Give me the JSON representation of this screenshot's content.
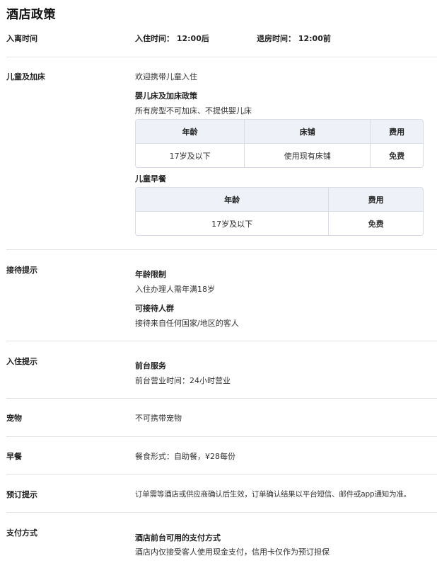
{
  "title": "酒店政策",
  "checkin": {
    "label": "入离时间",
    "checkin_text": "入住时间： 12:00后",
    "checkout_text": "退房时间： 12:00前"
  },
  "children": {
    "label": "儿童及加床",
    "welcome": "欢迎携带儿童入住",
    "crib_title": "婴儿床及加床政策",
    "crib_text": "所有房型不可加床、不提供婴儿床",
    "crib_table": {
      "headers": [
        "年龄",
        "床铺",
        "费用"
      ],
      "row": [
        "17岁及以下",
        "使用现有床铺",
        "免费"
      ]
    },
    "breakfast_title": "儿童早餐",
    "breakfast_table": {
      "headers": [
        "年龄",
        "费用"
      ],
      "row": [
        "17岁及以下",
        "免费"
      ]
    }
  },
  "reception": {
    "label": "接待提示",
    "age_title": "年龄限制",
    "age_text": "入住办理人需年满18岁",
    "guests_title": "可接待人群",
    "guests_text": "接待来自任何国家/地区的客人"
  },
  "checkin_tips": {
    "label": "入住提示",
    "desk_title": "前台服务",
    "desk_text": "前台营业时间：24小时营业"
  },
  "pets": {
    "label": "宠物",
    "text": "不可携带宠物"
  },
  "breakfast": {
    "label": "早餐",
    "text": "餐食形式：自助餐，¥28每份"
  },
  "booking": {
    "label": "预订提示",
    "text": "订单需等酒店或供应商确认后生效，订单确认结果以平台短信、邮件或app通知为准。"
  },
  "payment": {
    "label": "支付方式",
    "title": "酒店前台可用的支付方式",
    "text": "酒店内仅接受客人使用现金支付，信用卡仅作为预订担保"
  }
}
